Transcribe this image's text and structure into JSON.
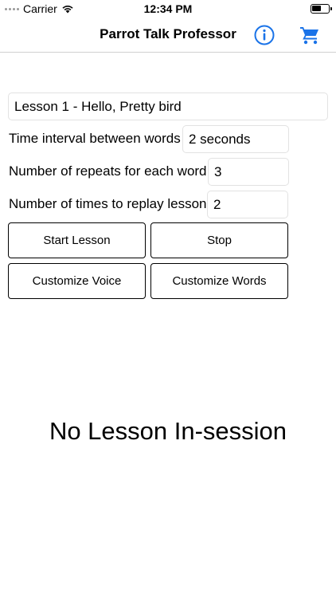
{
  "status_bar": {
    "carrier": "Carrier",
    "time": "12:34 PM",
    "battery_level": 0.6,
    "icons": [
      "signal-dots",
      "wifi-icon",
      "battery-icon"
    ]
  },
  "nav": {
    "title": "Parrot Talk Professor",
    "accent_color": "#1a73e8",
    "icons": [
      "info-icon",
      "cart-icon"
    ]
  },
  "lesson": {
    "selected": "Lesson 1 - Hello, Pretty bird"
  },
  "settings": {
    "interval_label": "Time interval between words",
    "interval_value": "2 seconds",
    "repeats_label": "Number of repeats for each word",
    "repeats_value": "3",
    "replays_label": "Number of times to replay lesson",
    "replays_value": "2"
  },
  "buttons": {
    "start": "Start Lesson",
    "stop": "Stop",
    "customize_voice": "Customize Voice",
    "customize_words": "Customize Words"
  },
  "status_message": "No Lesson In-session"
}
